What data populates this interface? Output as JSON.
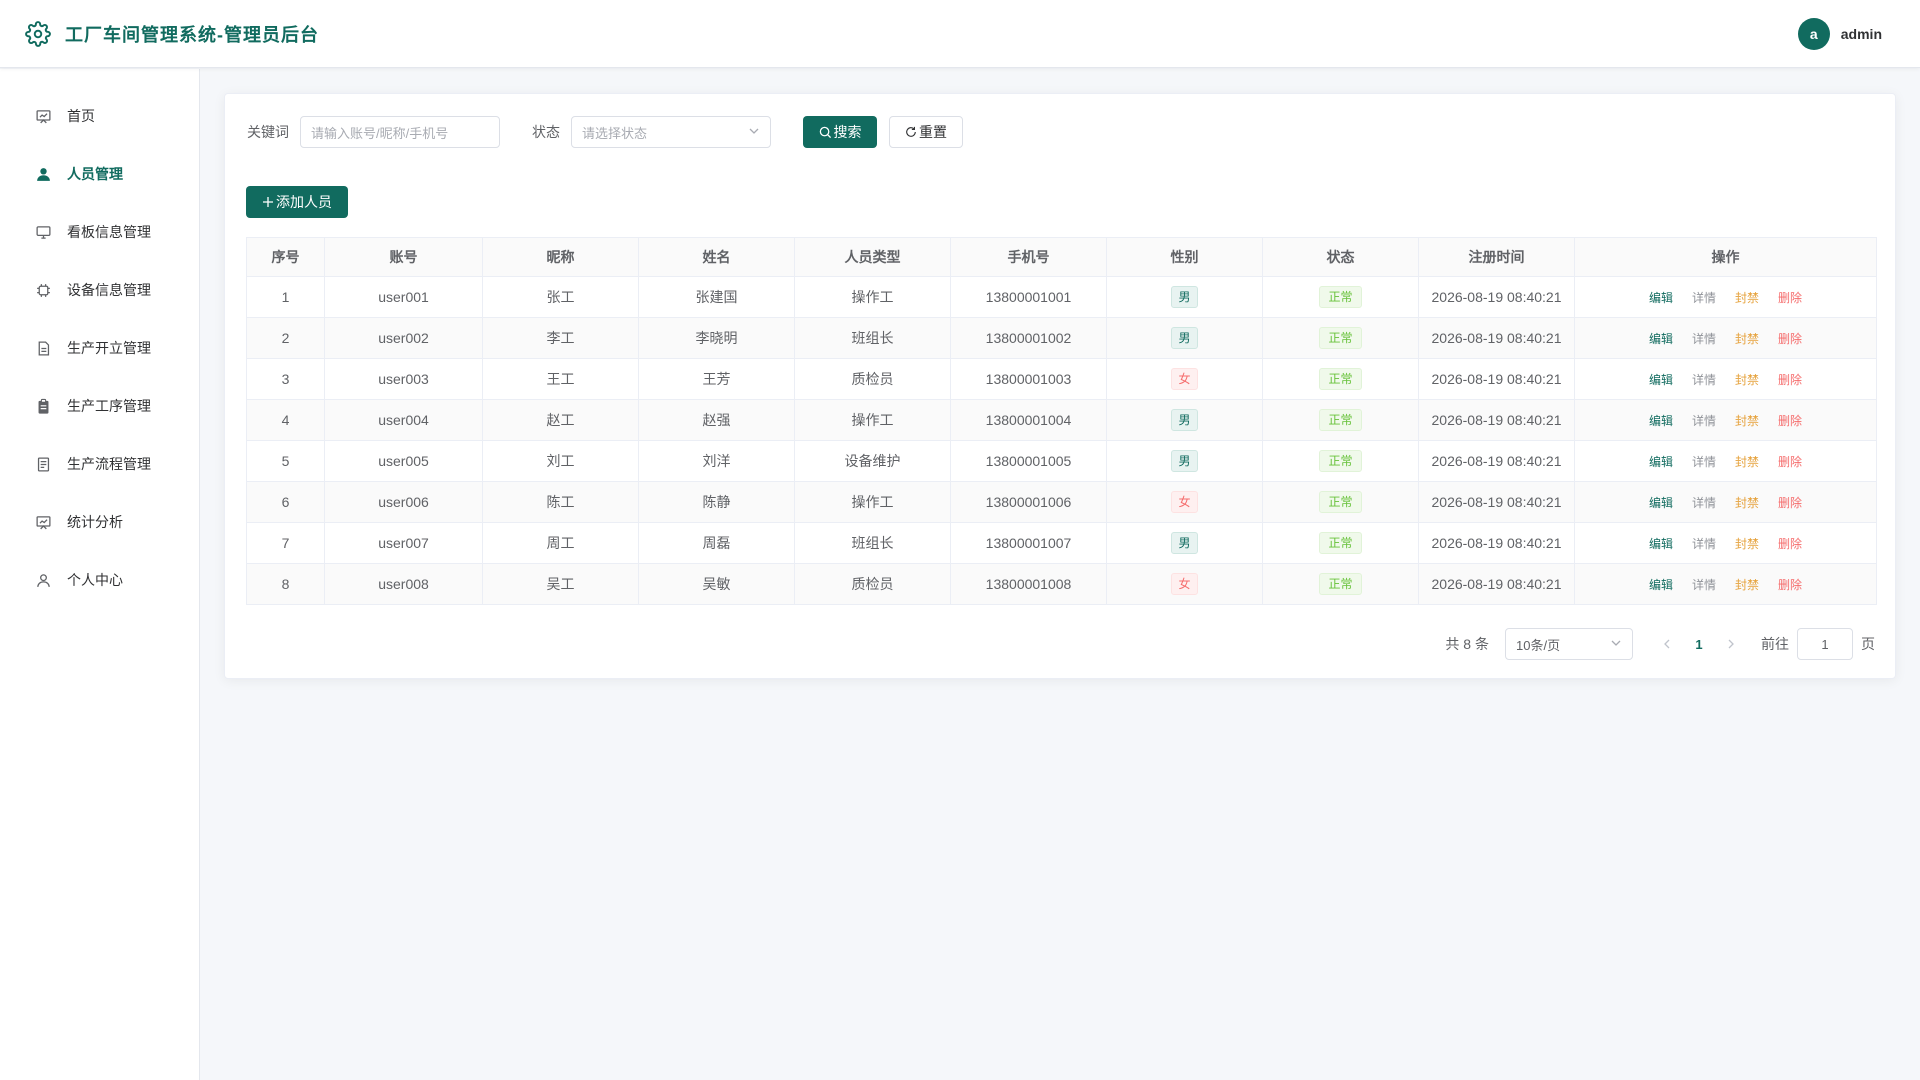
{
  "header": {
    "title": "工厂车间管理系统-管理员后台",
    "avatar_letter": "a",
    "username": "admin"
  },
  "sidebar": {
    "items": [
      {
        "label": "首页",
        "icon": "dashboard-icon"
      },
      {
        "label": "人员管理",
        "icon": "user-icon",
        "active": true
      },
      {
        "label": "看板信息管理",
        "icon": "monitor-icon"
      },
      {
        "label": "设备信息管理",
        "icon": "cpu-icon"
      },
      {
        "label": "生产开立管理",
        "icon": "document-icon"
      },
      {
        "label": "生产工序管理",
        "icon": "clipboard-icon"
      },
      {
        "label": "生产流程管理",
        "icon": "list-document-icon"
      },
      {
        "label": "统计分析",
        "icon": "chart-icon"
      },
      {
        "label": "个人中心",
        "icon": "person-icon"
      }
    ]
  },
  "filters": {
    "keyword_label": "关键词",
    "keyword_placeholder": "请输入账号/昵称/手机号",
    "status_label": "状态",
    "status_placeholder": "请选择状态",
    "search_label": "搜索",
    "reset_label": "重置"
  },
  "toolbar": {
    "add_label": "添加人员"
  },
  "table": {
    "columns": [
      "序号",
      "账号",
      "昵称",
      "姓名",
      "人员类型",
      "手机号",
      "性别",
      "状态",
      "注册时间",
      "操作"
    ],
    "actions": {
      "edit": "编辑",
      "detail": "详情",
      "ban": "封禁",
      "delete": "删除"
    },
    "rows": [
      {
        "index": "1",
        "account": "user001",
        "nickname": "张工",
        "name": "张建国",
        "type": "操作工",
        "phone": "13800001001",
        "gender": "男",
        "status": "正常",
        "registered": "2026-08-19 08:40:21"
      },
      {
        "index": "2",
        "account": "user002",
        "nickname": "李工",
        "name": "李晓明",
        "type": "班组长",
        "phone": "13800001002",
        "gender": "男",
        "status": "正常",
        "registered": "2026-08-19 08:40:21"
      },
      {
        "index": "3",
        "account": "user003",
        "nickname": "王工",
        "name": "王芳",
        "type": "质检员",
        "phone": "13800001003",
        "gender": "女",
        "status": "正常",
        "registered": "2026-08-19 08:40:21"
      },
      {
        "index": "4",
        "account": "user004",
        "nickname": "赵工",
        "name": "赵强",
        "type": "操作工",
        "phone": "13800001004",
        "gender": "男",
        "status": "正常",
        "registered": "2026-08-19 08:40:21"
      },
      {
        "index": "5",
        "account": "user005",
        "nickname": "刘工",
        "name": "刘洋",
        "type": "设备维护",
        "phone": "13800001005",
        "gender": "男",
        "status": "正常",
        "registered": "2026-08-19 08:40:21"
      },
      {
        "index": "6",
        "account": "user006",
        "nickname": "陈工",
        "name": "陈静",
        "type": "操作工",
        "phone": "13800001006",
        "gender": "女",
        "status": "正常",
        "registered": "2026-08-19 08:40:21"
      },
      {
        "index": "7",
        "account": "user007",
        "nickname": "周工",
        "name": "周磊",
        "type": "班组长",
        "phone": "13800001007",
        "gender": "男",
        "status": "正常",
        "registered": "2026-08-19 08:40:21"
      },
      {
        "index": "8",
        "account": "user008",
        "nickname": "吴工",
        "name": "吴敏",
        "type": "质检员",
        "phone": "13800001008",
        "gender": "女",
        "status": "正常",
        "registered": "2026-08-19 08:40:21"
      }
    ]
  },
  "pagination": {
    "total_text": "共 8 条",
    "page_size": "10条/页",
    "current_page": "1",
    "goto_label": "前往",
    "goto_value": "1",
    "goto_suffix": "页"
  },
  "colors": {
    "primary": "#116b5f",
    "danger": "#f56c6c",
    "warning": "#e6a23c",
    "success": "#67c23a"
  }
}
